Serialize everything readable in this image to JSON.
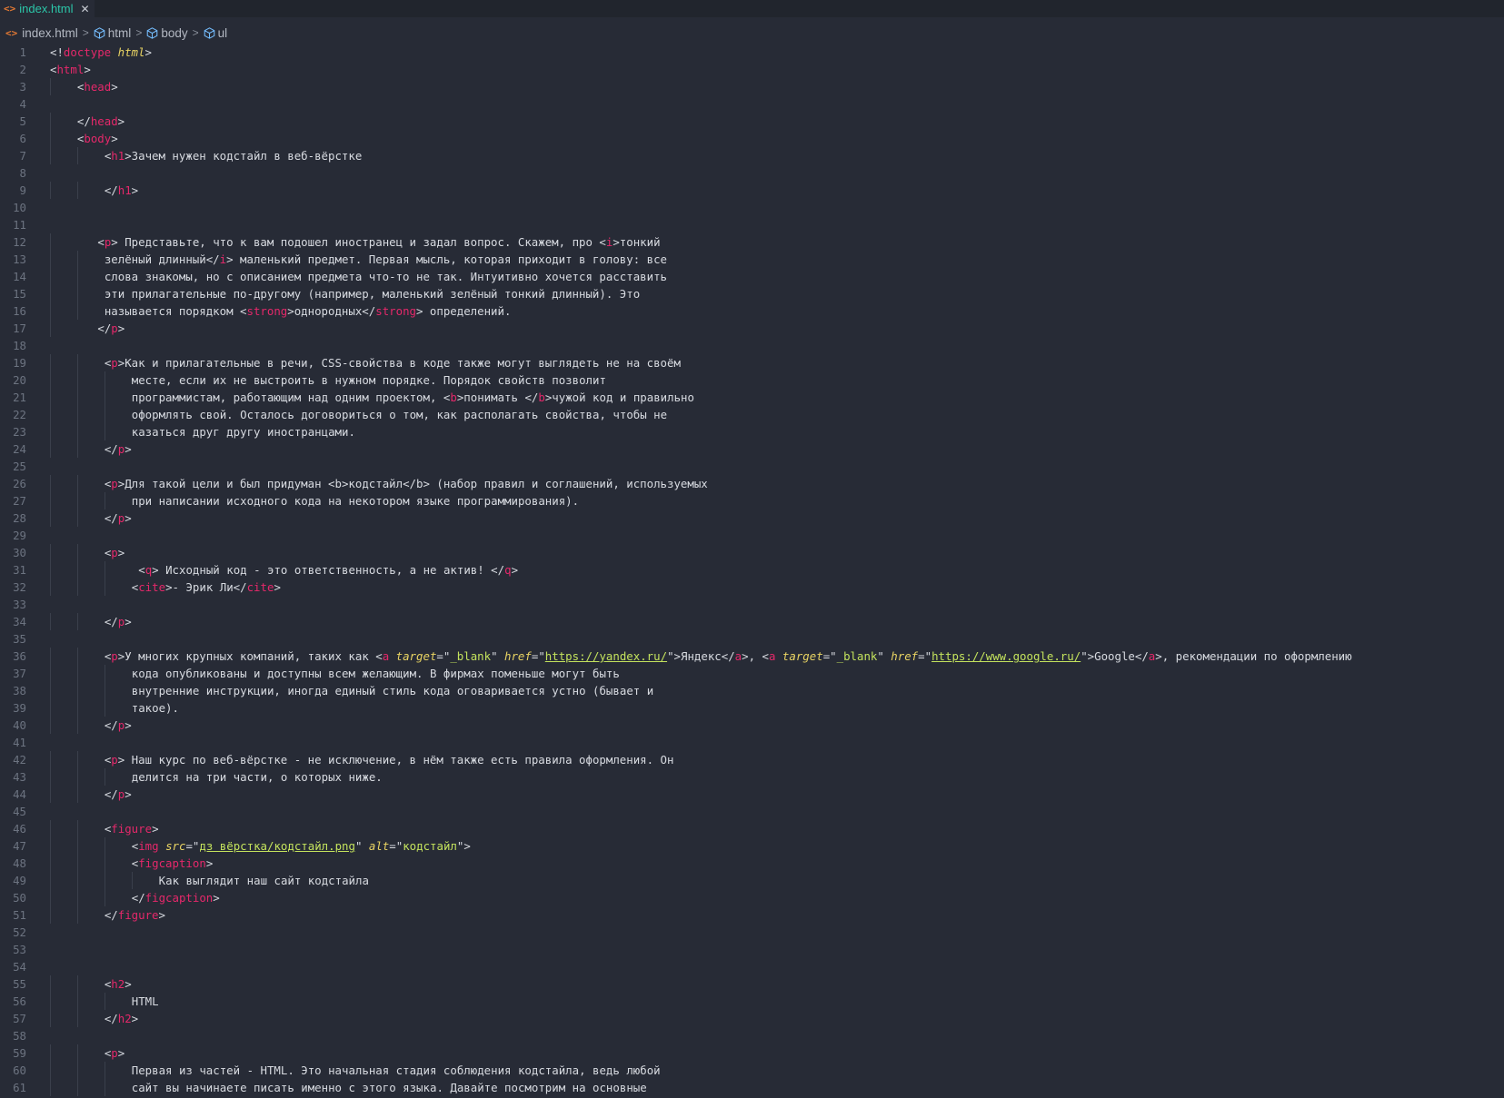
{
  "tab": {
    "file_name": "index.html",
    "close_symbol": "✕",
    "file_icon": "code-icon"
  },
  "breadcrumb": {
    "items": [
      "index.html",
      "html",
      "body",
      "ul"
    ],
    "icons": [
      "code-icon",
      "cube-icon",
      "cube-icon",
      "cube-icon"
    ]
  },
  "editor": {
    "lines": [
      {
        "n": "1",
        "indent": 0,
        "tokens": [
          [
            "p",
            "<!"
          ],
          [
            "kw",
            "doctype"
          ],
          [
            "p",
            " "
          ],
          [
            "doc",
            "html"
          ],
          [
            "p",
            ">"
          ]
        ]
      },
      {
        "n": "2",
        "indent": 0,
        "tokens": [
          [
            "p",
            "<"
          ],
          [
            "tag",
            "html"
          ],
          [
            "p",
            ">"
          ]
        ]
      },
      {
        "n": "3",
        "indent": 4,
        "tokens": [
          [
            "p",
            "<"
          ],
          [
            "tag",
            "head"
          ],
          [
            "p",
            ">"
          ]
        ]
      },
      {
        "n": "4",
        "indent": 0,
        "tokens": []
      },
      {
        "n": "5",
        "indent": 4,
        "tokens": [
          [
            "p",
            "</"
          ],
          [
            "tag",
            "head"
          ],
          [
            "p",
            ">"
          ]
        ]
      },
      {
        "n": "6",
        "indent": 4,
        "tokens": [
          [
            "p",
            "<"
          ],
          [
            "tag",
            "body"
          ],
          [
            "p",
            ">"
          ]
        ]
      },
      {
        "n": "7",
        "indent": 8,
        "tokens": [
          [
            "p",
            "<"
          ],
          [
            "tag",
            "h1"
          ],
          [
            "p",
            ">Зачем нужен кодстайл в веб-вёрстке"
          ]
        ]
      },
      {
        "n": "8",
        "indent": 0,
        "tokens": []
      },
      {
        "n": "9",
        "indent": 8,
        "tokens": [
          [
            "p",
            "</"
          ],
          [
            "tag",
            "h1"
          ],
          [
            "p",
            ">"
          ]
        ]
      },
      {
        "n": "10",
        "indent": 0,
        "tokens": []
      },
      {
        "n": "11",
        "indent": 0,
        "tokens": []
      },
      {
        "n": "12",
        "indent": 7,
        "tokens": [
          [
            "p",
            "<"
          ],
          [
            "tag",
            "p"
          ],
          [
            "p",
            "> Представьте, что к вам подошел иностранец и задал вопрос. Скажем, про <"
          ],
          [
            "tag",
            "i"
          ],
          [
            "p",
            ">тонкий"
          ]
        ]
      },
      {
        "n": "13",
        "indent": 8,
        "tokens": [
          [
            "p",
            "зелёный длинный</"
          ],
          [
            "tag",
            "i"
          ],
          [
            "p",
            "> маленький предмет. Первая мысль, которая приходит в голову: все"
          ]
        ]
      },
      {
        "n": "14",
        "indent": 8,
        "tokens": [
          [
            "p",
            "слова знакомы, но с описанием предмета что-то не так. Интуитивно хочется расставить"
          ]
        ]
      },
      {
        "n": "15",
        "indent": 8,
        "tokens": [
          [
            "p",
            "эти прилагательные по-другому (например, маленький зелёный тонкий длинный). Это"
          ]
        ]
      },
      {
        "n": "16",
        "indent": 8,
        "tokens": [
          [
            "p",
            "называется порядком <"
          ],
          [
            "tag",
            "strong"
          ],
          [
            "p",
            ">однородных</"
          ],
          [
            "tag",
            "strong"
          ],
          [
            "p",
            "> определений."
          ]
        ]
      },
      {
        "n": "17",
        "indent": 7,
        "tokens": [
          [
            "p",
            "</"
          ],
          [
            "tag",
            "p"
          ],
          [
            "p",
            ">"
          ]
        ]
      },
      {
        "n": "18",
        "indent": 0,
        "tokens": []
      },
      {
        "n": "19",
        "indent": 8,
        "tokens": [
          [
            "p",
            "<"
          ],
          [
            "tag",
            "p"
          ],
          [
            "p",
            ">Как и прилагательные в речи, CSS-свойства в коде также могут выглядеть не на своём"
          ]
        ]
      },
      {
        "n": "20",
        "indent": 12,
        "tokens": [
          [
            "p",
            "месте, если их не выстроить в нужном порядке. Порядок свойств позволит"
          ]
        ]
      },
      {
        "n": "21",
        "indent": 12,
        "tokens": [
          [
            "p",
            "программистам, работающим над одним проектом, <"
          ],
          [
            "tag",
            "b"
          ],
          [
            "p",
            ">понимать </"
          ],
          [
            "tag",
            "b"
          ],
          [
            "p",
            ">чужой код и правильно"
          ]
        ]
      },
      {
        "n": "22",
        "indent": 12,
        "tokens": [
          [
            "p",
            "оформлять свой. Осталось договориться о том, как располагать свойства, чтобы не"
          ]
        ]
      },
      {
        "n": "23",
        "indent": 12,
        "tokens": [
          [
            "p",
            "казаться друг другу иностранцами."
          ]
        ]
      },
      {
        "n": "24",
        "indent": 8,
        "tokens": [
          [
            "p",
            "</"
          ],
          [
            "tag",
            "p"
          ],
          [
            "p",
            ">"
          ]
        ]
      },
      {
        "n": "25",
        "indent": 0,
        "tokens": []
      },
      {
        "n": "26",
        "indent": 8,
        "tokens": [
          [
            "p",
            "<"
          ],
          [
            "tag",
            "p"
          ],
          [
            "p",
            ">Для такой цели и был придуман <b>кодстайл</b> (набор правил и соглашений, используемых"
          ]
        ]
      },
      {
        "n": "27",
        "indent": 12,
        "tokens": [
          [
            "p",
            "при написании исходного кода на некотором языке программирования)."
          ]
        ]
      },
      {
        "n": "28",
        "indent": 8,
        "tokens": [
          [
            "p",
            "</"
          ],
          [
            "tag",
            "p"
          ],
          [
            "p",
            ">"
          ]
        ]
      },
      {
        "n": "29",
        "indent": 0,
        "tokens": []
      },
      {
        "n": "30",
        "indent": 8,
        "tokens": [
          [
            "p",
            "<"
          ],
          [
            "tag",
            "p"
          ],
          [
            "p",
            ">"
          ]
        ]
      },
      {
        "n": "31",
        "indent": 13,
        "tokens": [
          [
            "p",
            "<"
          ],
          [
            "tag",
            "q"
          ],
          [
            "p",
            "> Исходный код - это ответственность, а не актив! </"
          ],
          [
            "tag",
            "q"
          ],
          [
            "p",
            ">"
          ]
        ]
      },
      {
        "n": "32",
        "indent": 12,
        "tokens": [
          [
            "p",
            "<"
          ],
          [
            "tag",
            "cite"
          ],
          [
            "p",
            ">- Эрик Ли</"
          ],
          [
            "tag",
            "cite"
          ],
          [
            "p",
            ">"
          ]
        ]
      },
      {
        "n": "33",
        "indent": 0,
        "tokens": []
      },
      {
        "n": "34",
        "indent": 8,
        "tokens": [
          [
            "p",
            "</"
          ],
          [
            "tag",
            "p"
          ],
          [
            "p",
            ">"
          ]
        ]
      },
      {
        "n": "35",
        "indent": 0,
        "tokens": []
      },
      {
        "n": "36",
        "indent": 8,
        "tokens": [
          [
            "p",
            "<"
          ],
          [
            "tag",
            "p"
          ],
          [
            "p",
            ">У многих крупных компаний, таких как <"
          ],
          [
            "tag",
            "a"
          ],
          [
            "p",
            " "
          ],
          [
            "attr",
            "target"
          ],
          [
            "p",
            "=\""
          ],
          [
            "str",
            "_blank"
          ],
          [
            "p",
            "\" "
          ],
          [
            "attr",
            "href"
          ],
          [
            "p",
            "=\""
          ],
          [
            "url",
            "https://yandex.ru/"
          ],
          [
            "p",
            "\">Яндекс</"
          ],
          [
            "tag",
            "a"
          ],
          [
            "p",
            ">, <"
          ],
          [
            "tag",
            "a"
          ],
          [
            "p",
            " "
          ],
          [
            "attr",
            "target"
          ],
          [
            "p",
            "=\""
          ],
          [
            "str",
            "_blank"
          ],
          [
            "p",
            "\" "
          ],
          [
            "attr",
            "href"
          ],
          [
            "p",
            "=\""
          ],
          [
            "url",
            "https://www.google.ru/"
          ],
          [
            "p",
            "\">Google</"
          ],
          [
            "tag",
            "a"
          ],
          [
            "p",
            ">, рекомендации по оформлению"
          ]
        ]
      },
      {
        "n": "37",
        "indent": 12,
        "tokens": [
          [
            "p",
            "кода опубликованы и доступны всем желающим. В фирмах поменьше могут быть"
          ]
        ]
      },
      {
        "n": "38",
        "indent": 12,
        "tokens": [
          [
            "p",
            "внутренние инструкции, иногда единый стиль кода оговаривается устно (бывает и"
          ]
        ]
      },
      {
        "n": "39",
        "indent": 12,
        "tokens": [
          [
            "p",
            "такое)."
          ]
        ]
      },
      {
        "n": "40",
        "indent": 8,
        "tokens": [
          [
            "p",
            "</"
          ],
          [
            "tag",
            "p"
          ],
          [
            "p",
            ">"
          ]
        ]
      },
      {
        "n": "41",
        "indent": 0,
        "tokens": []
      },
      {
        "n": "42",
        "indent": 8,
        "tokens": [
          [
            "p",
            "<"
          ],
          [
            "tag",
            "p"
          ],
          [
            "p",
            "> Наш курс по веб-вёрстке - не исключение, в нём также есть правила оформления. Он"
          ]
        ]
      },
      {
        "n": "43",
        "indent": 12,
        "tokens": [
          [
            "p",
            "делится на три части, о которых ниже."
          ]
        ]
      },
      {
        "n": "44",
        "indent": 8,
        "tokens": [
          [
            "p",
            "</"
          ],
          [
            "tag",
            "p"
          ],
          [
            "p",
            ">"
          ]
        ]
      },
      {
        "n": "45",
        "indent": 0,
        "tokens": []
      },
      {
        "n": "46",
        "indent": 8,
        "tokens": [
          [
            "p",
            "<"
          ],
          [
            "tag",
            "figure"
          ],
          [
            "p",
            ">"
          ]
        ]
      },
      {
        "n": "47",
        "indent": 12,
        "tokens": [
          [
            "p",
            "<"
          ],
          [
            "tag",
            "img"
          ],
          [
            "p",
            " "
          ],
          [
            "attr",
            "src"
          ],
          [
            "p",
            "=\""
          ],
          [
            "url",
            "дз вёрстка/кодстайл.png"
          ],
          [
            "p",
            "\" "
          ],
          [
            "attr",
            "alt"
          ],
          [
            "p",
            "=\""
          ],
          [
            "str",
            "кодстайл"
          ],
          [
            "p",
            "\">"
          ]
        ]
      },
      {
        "n": "48",
        "indent": 12,
        "tokens": [
          [
            "p",
            "<"
          ],
          [
            "tag",
            "figcaption"
          ],
          [
            "p",
            ">"
          ]
        ]
      },
      {
        "n": "49",
        "indent": 16,
        "tokens": [
          [
            "p",
            "Как выглядит наш сайт кодстайла"
          ]
        ]
      },
      {
        "n": "50",
        "indent": 12,
        "tokens": [
          [
            "p",
            "</"
          ],
          [
            "tag",
            "figcaption"
          ],
          [
            "p",
            ">"
          ]
        ]
      },
      {
        "n": "51",
        "indent": 8,
        "tokens": [
          [
            "p",
            "</"
          ],
          [
            "tag",
            "figure"
          ],
          [
            "p",
            ">"
          ]
        ]
      },
      {
        "n": "52",
        "indent": 0,
        "tokens": []
      },
      {
        "n": "53",
        "indent": 0,
        "tokens": []
      },
      {
        "n": "54",
        "indent": 0,
        "tokens": []
      },
      {
        "n": "55",
        "indent": 8,
        "tokens": [
          [
            "p",
            "<"
          ],
          [
            "tag",
            "h2"
          ],
          [
            "p",
            ">"
          ]
        ]
      },
      {
        "n": "56",
        "indent": 12,
        "tokens": [
          [
            "p",
            "HTML"
          ]
        ]
      },
      {
        "n": "57",
        "indent": 8,
        "tokens": [
          [
            "p",
            "</"
          ],
          [
            "tag",
            "h2"
          ],
          [
            "p",
            ">"
          ]
        ]
      },
      {
        "n": "58",
        "indent": 0,
        "tokens": []
      },
      {
        "n": "59",
        "indent": 8,
        "tokens": [
          [
            "p",
            "<"
          ],
          [
            "tag",
            "p"
          ],
          [
            "p",
            ">"
          ]
        ]
      },
      {
        "n": "60",
        "indent": 12,
        "tokens": [
          [
            "p",
            "Первая из частей - HTML. Это начальная стадия соблюдения кодстайла, ведь любой"
          ]
        ]
      },
      {
        "n": "61",
        "indent": 12,
        "tokens": [
          [
            "p",
            "сайт вы начинаете писать именно с этого языка. Давайте посмотрим на основные"
          ]
        ]
      }
    ]
  }
}
